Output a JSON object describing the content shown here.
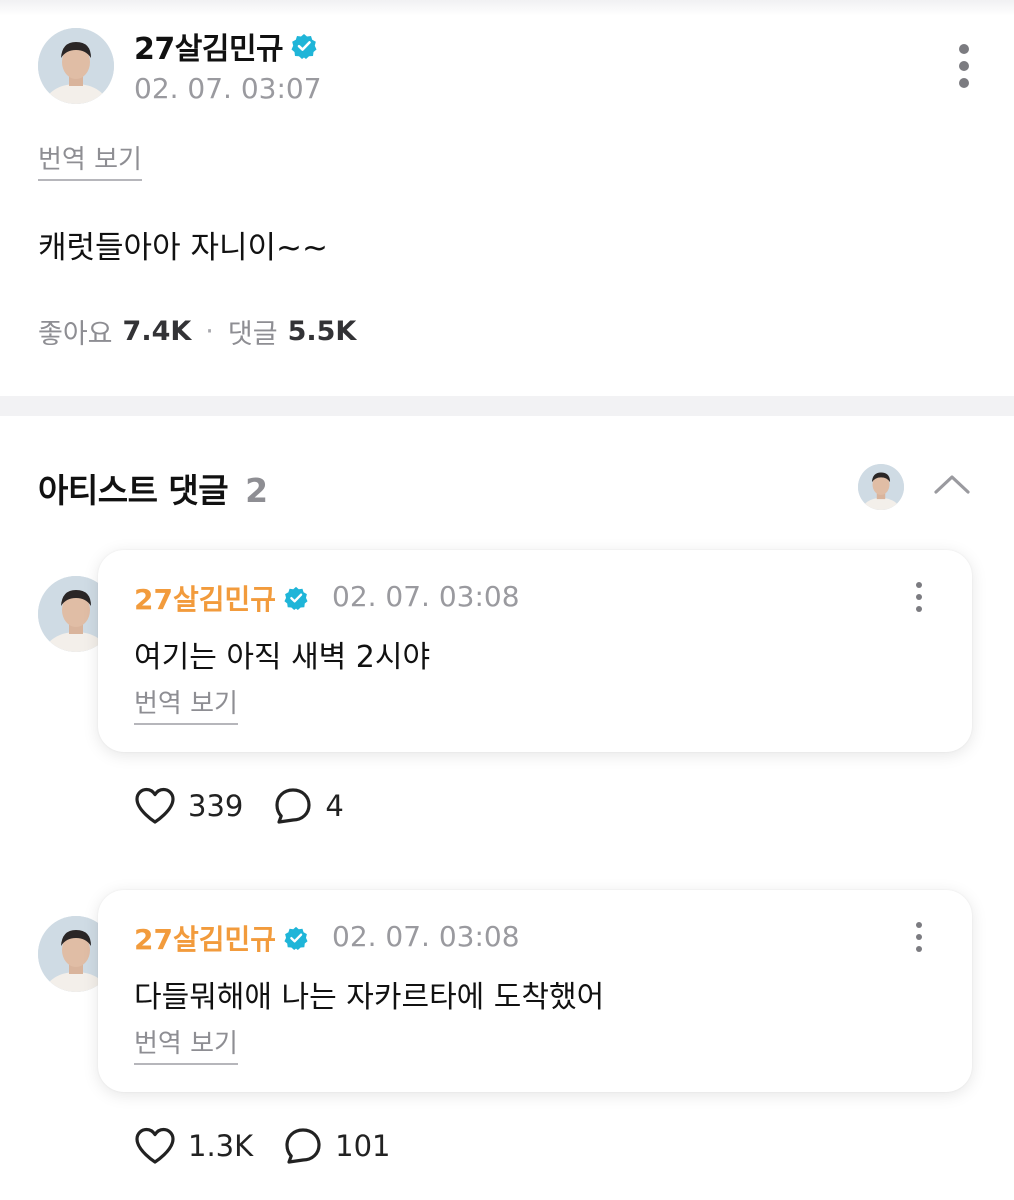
{
  "post": {
    "author": "27살김민규",
    "timestamp": "02. 07. 03:07",
    "translate_label": "번역 보기",
    "body": "캐럿들아아 자니이~~",
    "likes_label": "좋아요",
    "likes_count": "7.4K",
    "separator": "·",
    "comments_label": "댓글",
    "comments_count": "5.5K"
  },
  "artist_comments": {
    "title": "아티스트 댓글",
    "count": "2",
    "items": [
      {
        "author": "27살김민규",
        "timestamp": "02. 07. 03:08",
        "text": "여기는 아직 새벽 2시야",
        "translate_label": "번역 보기",
        "likes": "339",
        "replies": "4"
      },
      {
        "author": "27살김민규",
        "timestamp": "02. 07. 03:08",
        "text": "다들뭐해애 나는 자카르타에 도착했어",
        "translate_label": "번역 보기",
        "likes": "1.3K",
        "replies": "101"
      }
    ]
  },
  "icons": {
    "verified": "verified-badge-icon",
    "more": "more-vertical-icon",
    "collapse": "chevron-up-icon",
    "like": "heart-outline-icon",
    "reply": "speech-bubble-icon"
  },
  "colors": {
    "accent_name": "#f29b3c",
    "verified": "#1fb5d8",
    "muted_text": "#8e8e93",
    "divider": "#f2f2f4"
  }
}
